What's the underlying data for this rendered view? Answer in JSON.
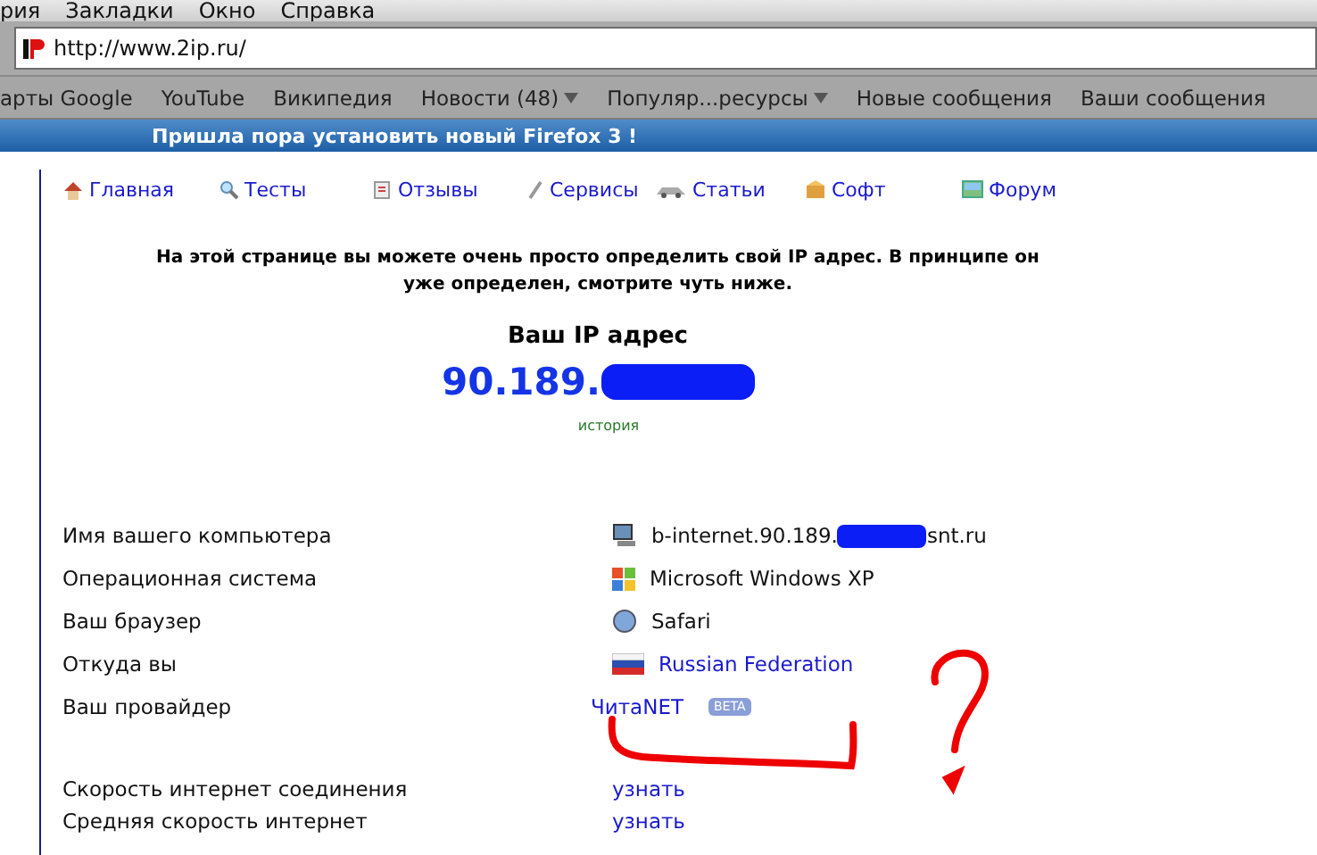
{
  "menu_bar": [
    "рия",
    "Закладки",
    "Окно",
    "Справка"
  ],
  "address_bar": {
    "url": "http://www.2ip.ru/"
  },
  "bookmarks": [
    {
      "label": "арты Google",
      "dropdown": false
    },
    {
      "label": "YouTube",
      "dropdown": false
    },
    {
      "label": "Википедия",
      "dropdown": false
    },
    {
      "label": "Новости (48)",
      "dropdown": true
    },
    {
      "label": "Популяр...ресурсы",
      "dropdown": true
    },
    {
      "label": "Новые сообщения",
      "dropdown": false
    },
    {
      "label": "Ваши сообщения",
      "dropdown": false
    }
  ],
  "banner": "Пришла пора установить новый Firefox 3 !",
  "nav": [
    {
      "label": "Главная",
      "kind": "home"
    },
    {
      "label": "Тесты",
      "kind": "tests"
    },
    {
      "label": "Отзывы",
      "kind": "reviews"
    },
    {
      "label": "Сервисы",
      "kind": "services"
    },
    {
      "label": "Статьи",
      "kind": "articles"
    },
    {
      "label": "Софт",
      "kind": "soft"
    },
    {
      "label": "Форум",
      "kind": "forum"
    }
  ],
  "intro": "На этой странице вы можете очень просто определить свой IP адрес. В принципе он уже определен, смотрите чуть ниже.",
  "ip_heading": "Ваш IP адрес",
  "ip_value": "90.189.",
  "history_link": "история",
  "info_rows": [
    {
      "label": "Имя вашего компьютера",
      "kind": "host",
      "value": "b-internet.90.189.",
      "value_end": "snt.ru"
    },
    {
      "label": "Операционная система",
      "kind": "os",
      "value": "Microsoft Windows XP"
    },
    {
      "label": "Ваш браузер",
      "kind": "browser",
      "value": "Safari"
    },
    {
      "label": "Откуда вы",
      "kind": "country",
      "value": "Russian Federation"
    },
    {
      "label": "Ваш провайдер",
      "kind": "provider",
      "value": "ЧитаNET",
      "badge": "BETA"
    }
  ],
  "speed_rows": [
    {
      "label": "Скорость интернет соединения",
      "link": "узнать"
    },
    {
      "label": "Средняя скорость интернет",
      "link": "узнать"
    }
  ]
}
